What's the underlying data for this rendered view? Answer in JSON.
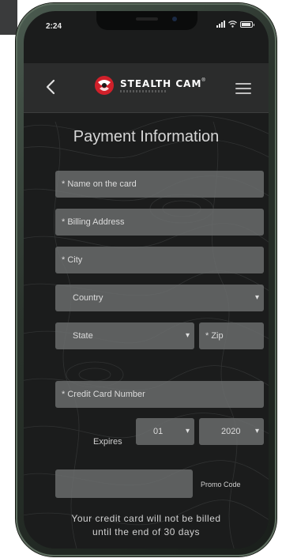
{
  "status_bar": {
    "time": "2:24"
  },
  "header": {
    "logo_text": "STEALTH CAM",
    "logo_symbol": "®"
  },
  "page": {
    "title": "Payment Information"
  },
  "form": {
    "name_on_card": {
      "value": "",
      "placeholder": "* Name on the card"
    },
    "billing_address": {
      "value": "",
      "placeholder": "* Billing Address"
    },
    "city": {
      "value": "",
      "placeholder": "* City"
    },
    "country": {
      "selected": "Country"
    },
    "state": {
      "selected": "State"
    },
    "zip": {
      "value": "",
      "placeholder": "* Zip"
    },
    "credit_card_number": {
      "value": "",
      "placeholder": "* Credit Card Number"
    },
    "expires_label": "Expires",
    "expiry_month": {
      "selected": "01"
    },
    "expiry_year": {
      "selected": "2020"
    },
    "promo_code": {
      "value": "",
      "label": "Promo Code"
    },
    "billing_note_line1": "Your credit card will not be billed",
    "billing_note_line2": "until the end of 30 days"
  },
  "icons": {
    "back": "chevron-left-icon",
    "menu": "hamburger-menu-icon",
    "caret": "caret-down-icon",
    "logo": "stealth-cam-logo-icon"
  },
  "colors": {
    "field_bg": "#707272",
    "screen_bg": "#1b1c1c",
    "header_bg": "#2b2c2c",
    "logo_red": "#d0202a",
    "text_light": "#dcdcdc"
  }
}
